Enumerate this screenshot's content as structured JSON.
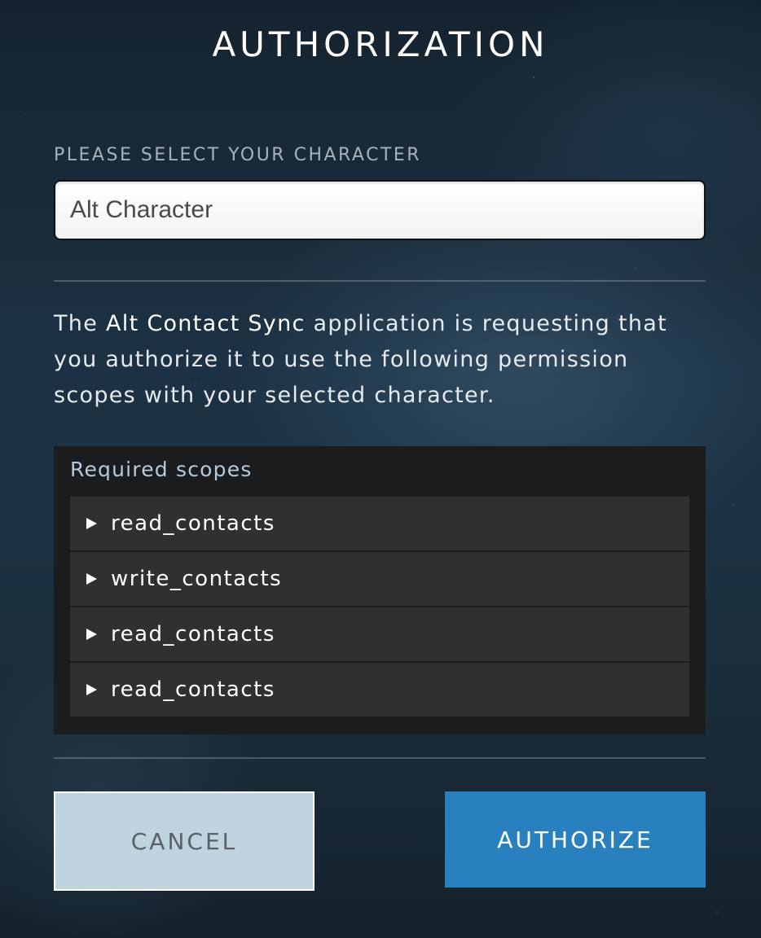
{
  "header": {
    "title": "AUTHORIZATION"
  },
  "character_select": {
    "label": "PLEASE SELECT YOUR CHARACTER",
    "selected_value": "Alt Character"
  },
  "request": {
    "prefix": "The ",
    "app_name": "Alt Contact Sync",
    "suffix": " application is requesting that you authorize it to use the following permission scopes with your selected character."
  },
  "scopes": {
    "heading": "Required scopes",
    "items": [
      {
        "name": "read_contacts"
      },
      {
        "name": "write_contacts"
      },
      {
        "name": "read_contacts"
      },
      {
        "name": "read_contacts"
      }
    ]
  },
  "actions": {
    "cancel_label": "CANCEL",
    "authorize_label": "AUTHORIZE"
  },
  "colors": {
    "accent": "#2980be",
    "cancel_bg": "#c0d4df",
    "panel_bg": "#1b1c1d",
    "scope_row_bg": "#303030"
  },
  "icons": {
    "scope_expand": "triangle-right-icon"
  }
}
